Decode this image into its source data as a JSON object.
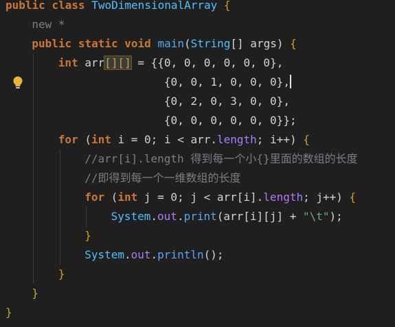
{
  "editor": {
    "colors": {
      "background": "#1f1f1f",
      "keyword": "#cc7832",
      "type_name": "#4fc1ff",
      "method": "#56a8f5",
      "field": "#ab7df8",
      "comment": "#7a7e85",
      "string": "#6aab73",
      "number": "#d4d4d4",
      "plain": "#d4d4d4",
      "brace": "#c9a227"
    },
    "bulb_icon": "lightbulb-icon",
    "lines": [
      {
        "indent": 0,
        "tokens": [
          {
            "t": "public",
            "c": "keyword"
          },
          {
            "t": " ",
            "c": "plain"
          },
          {
            "t": "class",
            "c": "keyword"
          },
          {
            "t": " ",
            "c": "plain"
          },
          {
            "t": "TwoDimensionalArray",
            "c": "type_name"
          },
          {
            "t": " {",
            "c": "brace"
          }
        ]
      },
      {
        "indent": 1,
        "tokens": [
          {
            "t": "new *",
            "c": "comment"
          }
        ]
      },
      {
        "indent": 1,
        "tokens": [
          {
            "t": "public",
            "c": "keyword"
          },
          {
            "t": " ",
            "c": "plain"
          },
          {
            "t": "static",
            "c": "keyword"
          },
          {
            "t": " ",
            "c": "plain"
          },
          {
            "t": "void",
            "c": "keyword"
          },
          {
            "t": " ",
            "c": "plain"
          },
          {
            "t": "main",
            "c": "method"
          },
          {
            "t": "(",
            "c": "plain"
          },
          {
            "t": "String",
            "c": "type_name"
          },
          {
            "t": "[] args) ",
            "c": "plain"
          },
          {
            "t": "{",
            "c": "brace"
          }
        ]
      },
      {
        "indent": 2,
        "tokens": [
          {
            "t": "int",
            "c": "keyword"
          },
          {
            "t": " arr",
            "c": "plain"
          },
          {
            "t": "[][]",
            "c": "brace_match"
          },
          {
            "t": " = {{0, 0, 0, 0, 0, 0},",
            "c": "plain"
          }
        ]
      },
      {
        "indent": 2,
        "pad": "                ",
        "bulb": true,
        "caret": true,
        "tokens": [
          {
            "t": "{0, 0, 1, 0, 0, 0},",
            "c": "plain"
          }
        ]
      },
      {
        "indent": 2,
        "pad": "                ",
        "tokens": [
          {
            "t": "{0, 2, 0, 3, 0, 0},",
            "c": "plain"
          }
        ]
      },
      {
        "indent": 2,
        "pad": "                ",
        "tokens": [
          {
            "t": "{0, 0, 0, 0, 0, 0}};",
            "c": "plain"
          }
        ]
      },
      {
        "indent": 2,
        "tokens": [
          {
            "t": "for",
            "c": "keyword"
          },
          {
            "t": " (",
            "c": "plain"
          },
          {
            "t": "int",
            "c": "keyword"
          },
          {
            "t": " i = 0; i < arr.",
            "c": "plain"
          },
          {
            "t": "length",
            "c": "field"
          },
          {
            "t": "; i++) ",
            "c": "plain"
          },
          {
            "t": "{",
            "c": "brace"
          }
        ]
      },
      {
        "indent": 3,
        "tokens": [
          {
            "t": "//arr[i].length 得到每一个小{}里面的数组的长度",
            "c": "comment"
          }
        ]
      },
      {
        "indent": 3,
        "tokens": [
          {
            "t": "//即得到每一个一维数组的长度",
            "c": "comment"
          }
        ]
      },
      {
        "indent": 3,
        "tokens": [
          {
            "t": "for",
            "c": "keyword"
          },
          {
            "t": " (",
            "c": "plain"
          },
          {
            "t": "int",
            "c": "keyword"
          },
          {
            "t": " j = 0; j < arr[i].",
            "c": "plain"
          },
          {
            "t": "length",
            "c": "field"
          },
          {
            "t": "; j++) ",
            "c": "plain"
          },
          {
            "t": "{",
            "c": "brace"
          }
        ]
      },
      {
        "indent": 4,
        "tokens": [
          {
            "t": "System",
            "c": "type_name"
          },
          {
            "t": ".",
            "c": "plain"
          },
          {
            "t": "out",
            "c": "field"
          },
          {
            "t": ".",
            "c": "plain"
          },
          {
            "t": "print",
            "c": "method"
          },
          {
            "t": "(arr[i][j] + ",
            "c": "plain"
          },
          {
            "t": "\"\\t\"",
            "c": "string"
          },
          {
            "t": ");",
            "c": "plain"
          }
        ]
      },
      {
        "indent": 3,
        "tokens": [
          {
            "t": "}",
            "c": "brace"
          }
        ]
      },
      {
        "indent": 3,
        "tokens": [
          {
            "t": "System",
            "c": "type_name"
          },
          {
            "t": ".",
            "c": "plain"
          },
          {
            "t": "out",
            "c": "field"
          },
          {
            "t": ".",
            "c": "plain"
          },
          {
            "t": "println",
            "c": "method"
          },
          {
            "t": "();",
            "c": "plain"
          }
        ]
      },
      {
        "indent": 2,
        "tokens": [
          {
            "t": "}",
            "c": "brace"
          }
        ]
      },
      {
        "indent": 1,
        "tokens": [
          {
            "t": "}",
            "c": "brace"
          }
        ]
      },
      {
        "indent": 0,
        "tokens": [
          {
            "t": "}",
            "c": "brace"
          }
        ]
      }
    ]
  }
}
